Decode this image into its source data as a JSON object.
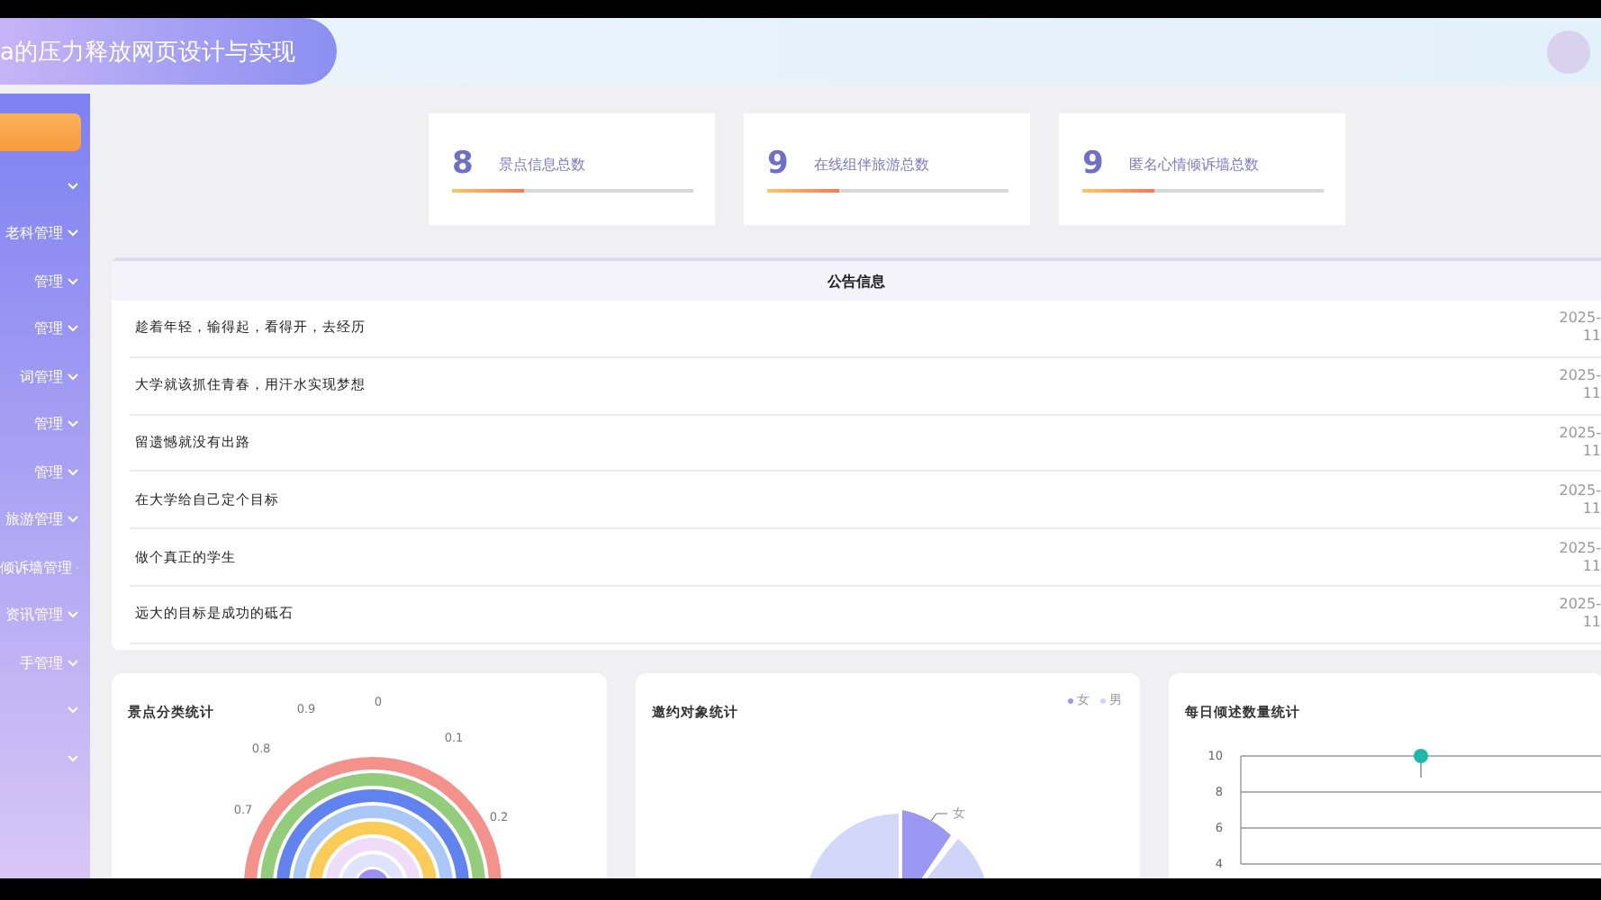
{
  "header": {
    "title": "a的压力释放网页设计与实现"
  },
  "sidebar": {
    "items": [
      {
        "selected": true
      },
      {
        "selected": false
      },
      {
        "label": "老科管理",
        "selected": false
      },
      {
        "label": "管理",
        "selected": false
      },
      {
        "label": "管理",
        "selected": false
      },
      {
        "label": "词管理",
        "selected": false
      },
      {
        "label": "管理",
        "selected": false
      },
      {
        "label": "管理",
        "selected": false
      },
      {
        "label": "旅游管理",
        "selected": false
      },
      {
        "label": "倾诉墙管理",
        "selected": false
      },
      {
        "label": "资讯管理",
        "selected": false
      },
      {
        "label": "手管理",
        "selected": false
      },
      {
        "selected": false
      },
      {
        "selected": false
      }
    ]
  },
  "stats": [
    {
      "value": "8",
      "label": "景点信息总数",
      "level": 0.3
    },
    {
      "value": "9",
      "label": "在线组伴旅游总数",
      "level": 0.3
    },
    {
      "value": "9",
      "label": "匿名心情倾诉墙总数",
      "level": 0.3
    }
  ],
  "notices": {
    "title": "公告信息",
    "rows": [
      {
        "text": "趁着年轻，输得起，看得开，去经历",
        "date": "2025-",
        "date_2": "11"
      },
      {
        "text": "大学就该抓住青春，用汗水实现梦想",
        "date": "2025-",
        "date_2": "11"
      },
      {
        "text": "留遗憾就没有出路",
        "date": "2025-",
        "date_2": "11"
      },
      {
        "text": "在大学给自己定个目标",
        "date": "2025-",
        "date_2": "11"
      },
      {
        "text": "做个真正的学生",
        "date": "2025-",
        "date_2": "11"
      },
      {
        "text": "远大的目标是成功的砥石",
        "date": "2025-",
        "date_2": "11"
      }
    ]
  },
  "charts": [
    {
      "kind": "polar",
      "title": "景点分类统计",
      "angle_ticks": [
        "0.7",
        "0.8",
        "0.9",
        "0",
        "0.1",
        "0.2"
      ]
    },
    {
      "kind": "pie",
      "title": "邀约对象统计",
      "legend": [
        "女",
        "男"
      ],
      "slice_label": "女"
    },
    {
      "kind": "line",
      "title": "每日倾述数量统计",
      "chart_data": {
        "type": "scatter",
        "ylim": [
          4,
          10
        ],
        "yticks": [
          4,
          6,
          8,
          10
        ],
        "values": [
          10
        ]
      }
    }
  ]
}
